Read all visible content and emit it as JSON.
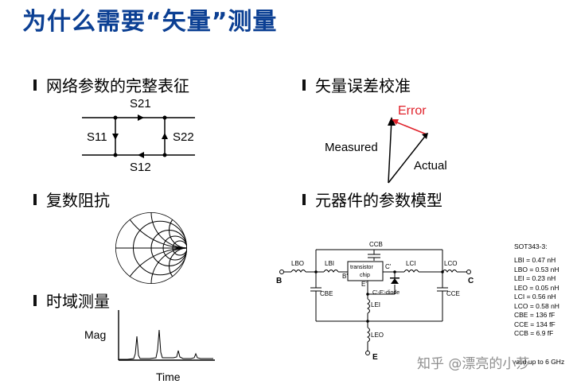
{
  "title": "为什么需要“矢量”测量",
  "sections": {
    "network": "网络参数的完整表征",
    "vector_error": "矢量误差校准",
    "impedance": "复数阻抗",
    "model": "元器件的参数模型",
    "time_domain": "时域测量"
  },
  "sparams": {
    "s21": "S21",
    "s11": "S11",
    "s22": "S22",
    "s12": "S12"
  },
  "vector": {
    "error": "Error",
    "measured": "Measured",
    "actual": "Actual",
    "error_color": "#e0222b"
  },
  "time_plot": {
    "ylabel": "Mag",
    "xlabel": "Time"
  },
  "circuit": {
    "ccb": "CCB",
    "lbo": "LBO",
    "lbi": "LBI",
    "transistor": "transistor",
    "chip": "chip",
    "c_prime": "C'",
    "b_prime": "B'",
    "e_prime": "E'",
    "lci": "LCI",
    "lco": "LCO",
    "b": "B",
    "c": "C",
    "cbe": "CBE",
    "cce": "CCE",
    "diode": "C'-E'-diode",
    "lei": "LEI",
    "leo": "LEO",
    "e": "E"
  },
  "params": {
    "title": "SOT343-3:",
    "lines": [
      "LBI = 0.47 nH",
      "LBO = 0.53 nH",
      "LEI = 0.23 nH",
      "LEO = 0.05 nH",
      "LCI = 0.56 nH",
      "LCO = 0.58 nH",
      "CBE = 136 fF",
      "CCE = 134 fF",
      "CCB = 6.9 fF"
    ],
    "footer": "valid up to 6 GHz"
  },
  "watermark": "知乎 @漂亮的小莎"
}
